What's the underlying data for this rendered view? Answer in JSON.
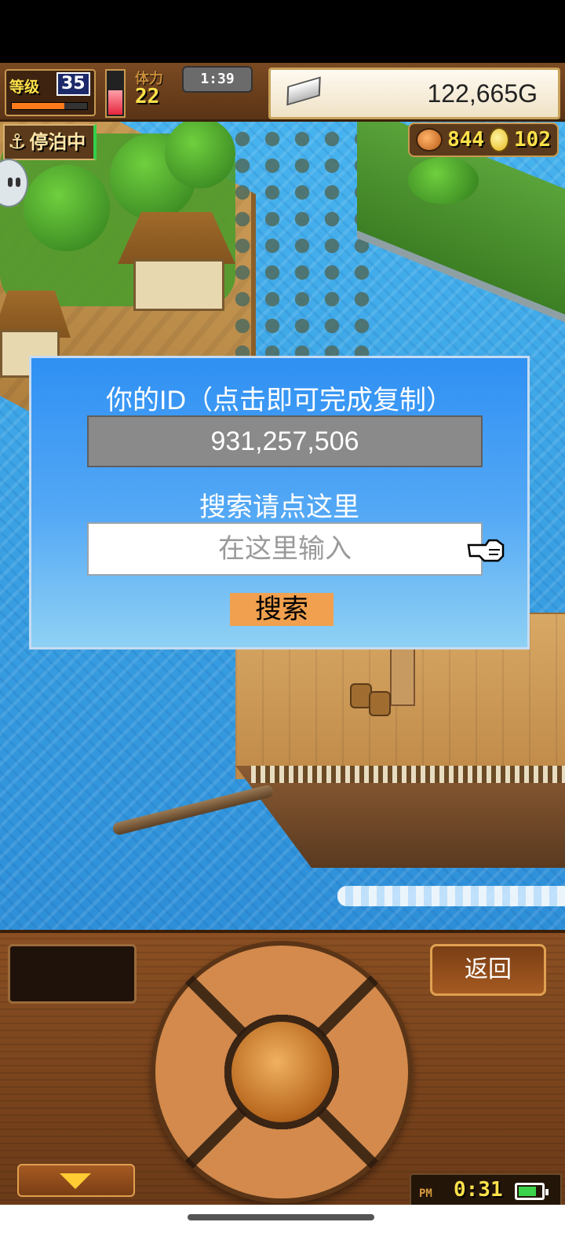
{
  "hud": {
    "level_label": "等级",
    "level": "35",
    "exp_progress": 0.7,
    "stamina_label": "体力",
    "stamina": "22",
    "stamina_fill": 0.6,
    "timer": "1:39",
    "gold": "122,665G",
    "status": "停泊中",
    "food": "844",
    "medals": "102"
  },
  "dialog": {
    "title": "你的ID（点击即可完成复制）",
    "id_value": "931,257,506",
    "search_label": "搜索请点这里",
    "search_placeholder": "在这里输入",
    "search_button": "搜索"
  },
  "controls": {
    "back_button": "返回",
    "clock_ampm": "PM",
    "clock_time": "0:31",
    "battery_level": 0.8
  },
  "colors": {
    "dialog_top": "#2f90f3",
    "dialog_bottom": "#8fd1f4",
    "search_button_bg": "#f0a04e",
    "id_box_bg": "#8a8a8a"
  }
}
